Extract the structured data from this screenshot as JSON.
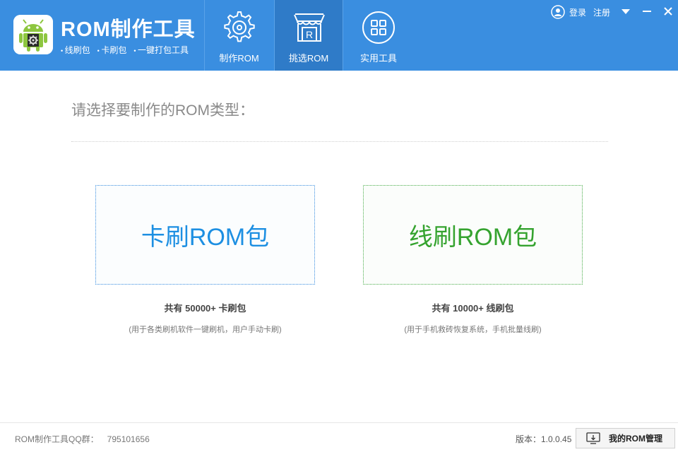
{
  "header": {
    "app_title": "ROM制作工具",
    "features": [
      "线刷包",
      "卡刷包",
      "一键打包工具"
    ],
    "nav": [
      {
        "label": "制作ROM",
        "icon": "gear-disc-icon",
        "active": false
      },
      {
        "label": "挑选ROM",
        "icon": "shop-rom-icon",
        "active": true
      },
      {
        "label": "实用工具",
        "icon": "grid-apps-icon",
        "active": false
      }
    ],
    "login_label": "登录",
    "register_label": "注册"
  },
  "main": {
    "prompt": "请选择要制作的ROM类型：",
    "cards": [
      {
        "title": "卡刷ROM包",
        "count": "共有 50000+ 卡刷包",
        "desc": "(用于各类刷机软件一键刷机，用户手动卡刷)",
        "color": "#1d8fe2"
      },
      {
        "title": "线刷ROM包",
        "count": "共有 10000+ 线刷包",
        "desc": "(用于手机救砖恢复系统，手机批量线刷)",
        "color": "#35a32f"
      }
    ]
  },
  "footer": {
    "qq_label": "ROM制作工具QQ群：",
    "qq_number": "795101656",
    "version": "版本：1.0.0.45",
    "manager_button": "我的ROM管理"
  },
  "colors": {
    "header_bg": "#3a8ee0",
    "nav_active_bg": "#2f7bc8",
    "blue": "#1d8fe2",
    "green": "#35a32f"
  }
}
